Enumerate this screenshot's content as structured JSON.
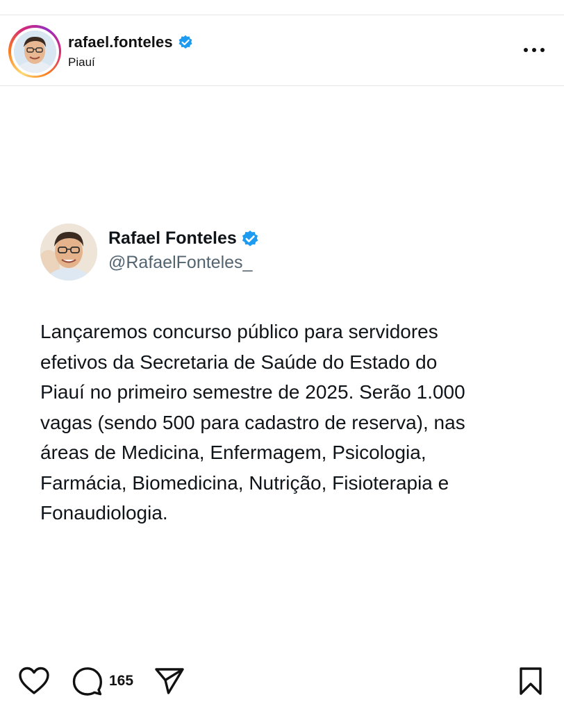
{
  "post": {
    "username": "rafael.fonteles",
    "location": "Piauí",
    "verified": true
  },
  "tweet": {
    "name": "Rafael Fonteles",
    "handle": "@RafaelFonteles_",
    "verified": true,
    "text": "Lançaremos concurso público para servidores\nefetivos da Secretaria de Saúde do Estado do\nPiauí no primeiro semestre de 2025. Serão 1.000\nvagas (sendo 500 para cadastro de reserva), nas\náreas de Medicina, Enfermagem, Psicologia,\nFarmácia, Biomedicina, Nutrição, Fisioterapia e\nFonaudiologia."
  },
  "actions": {
    "comment_count": "165",
    "icons": [
      "heart-icon",
      "comment-icon",
      "share-icon",
      "bookmark-icon",
      "more-icon"
    ]
  },
  "colors": {
    "verified_blue": "#1d9bf0",
    "handle_gray": "#536471",
    "divider": "#e6e6e6"
  }
}
